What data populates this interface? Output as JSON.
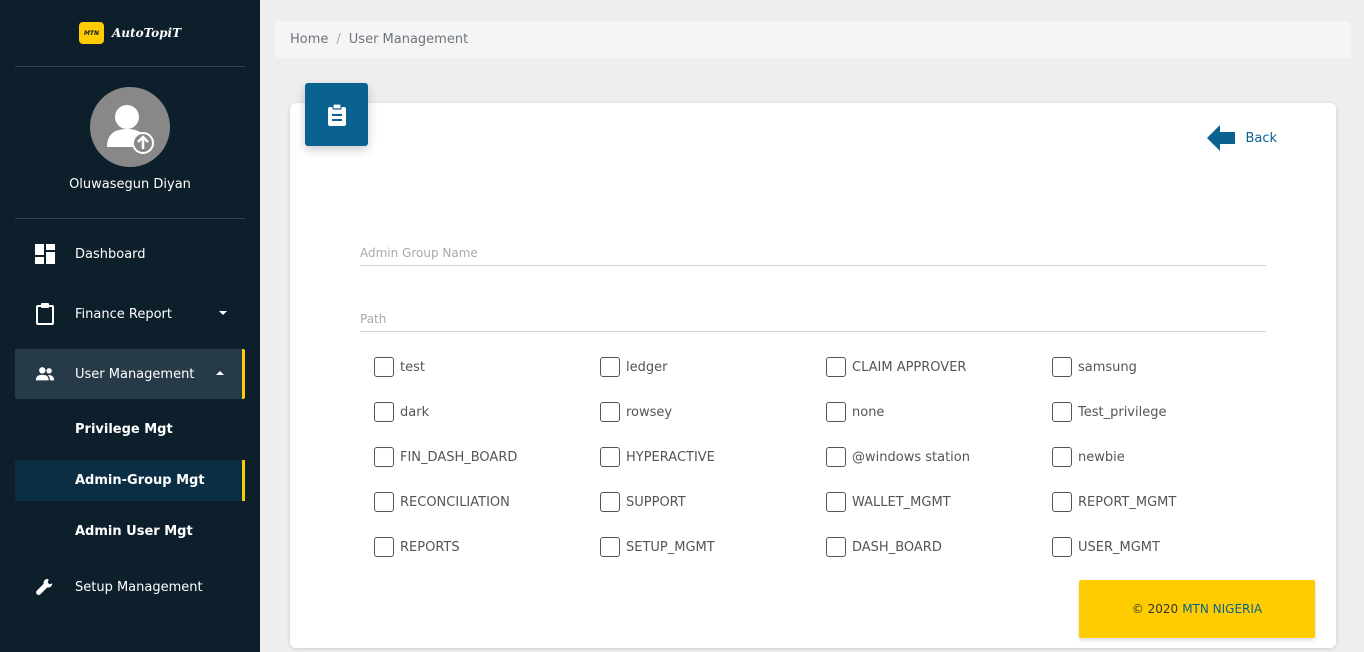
{
  "brand": {
    "logo_text": "MTN",
    "name": "AutoTopiT"
  },
  "user": {
    "name": "Oluwasegun Diyan"
  },
  "sidebar": {
    "items": [
      {
        "label": "Dashboard",
        "icon": "dashboard-icon"
      },
      {
        "label": "Finance Report",
        "icon": "clipboard-icon"
      },
      {
        "label": "User Management",
        "icon": "users-icon"
      },
      {
        "label": "Setup Management",
        "icon": "wrench-icon"
      }
    ],
    "sub_items": [
      {
        "label": "Privilege Mgt"
      },
      {
        "label": "Admin-Group Mgt"
      },
      {
        "label": "Admin User Mgt"
      }
    ]
  },
  "breadcrumb": {
    "home": "Home",
    "separator": "/",
    "current": "User Management"
  },
  "card": {
    "back_label": "Back",
    "admin_group_placeholder": "Admin Group Name",
    "path_placeholder": "Path"
  },
  "privileges": [
    "test",
    "ledger",
    "CLAIM APPROVER",
    "samsung",
    "dark",
    "rowsey",
    "none",
    "Test_privilege",
    "FIN_DASH_BOARD",
    "HYPERACTIVE",
    "@windows station",
    "newbie",
    "RECONCILIATION",
    "SUPPORT",
    "WALLET_MGMT",
    "REPORT_MGMT",
    "REPORTS",
    "SETUP_MGMT",
    "DASH_BOARD",
    "USER_MGMT"
  ],
  "footer": {
    "copyright": "© 2020",
    "company": "MTN NIGERIA"
  },
  "colors": {
    "sidebar": "#0d1f2b",
    "accent": "#ffcb05",
    "primary": "#0a6290"
  }
}
